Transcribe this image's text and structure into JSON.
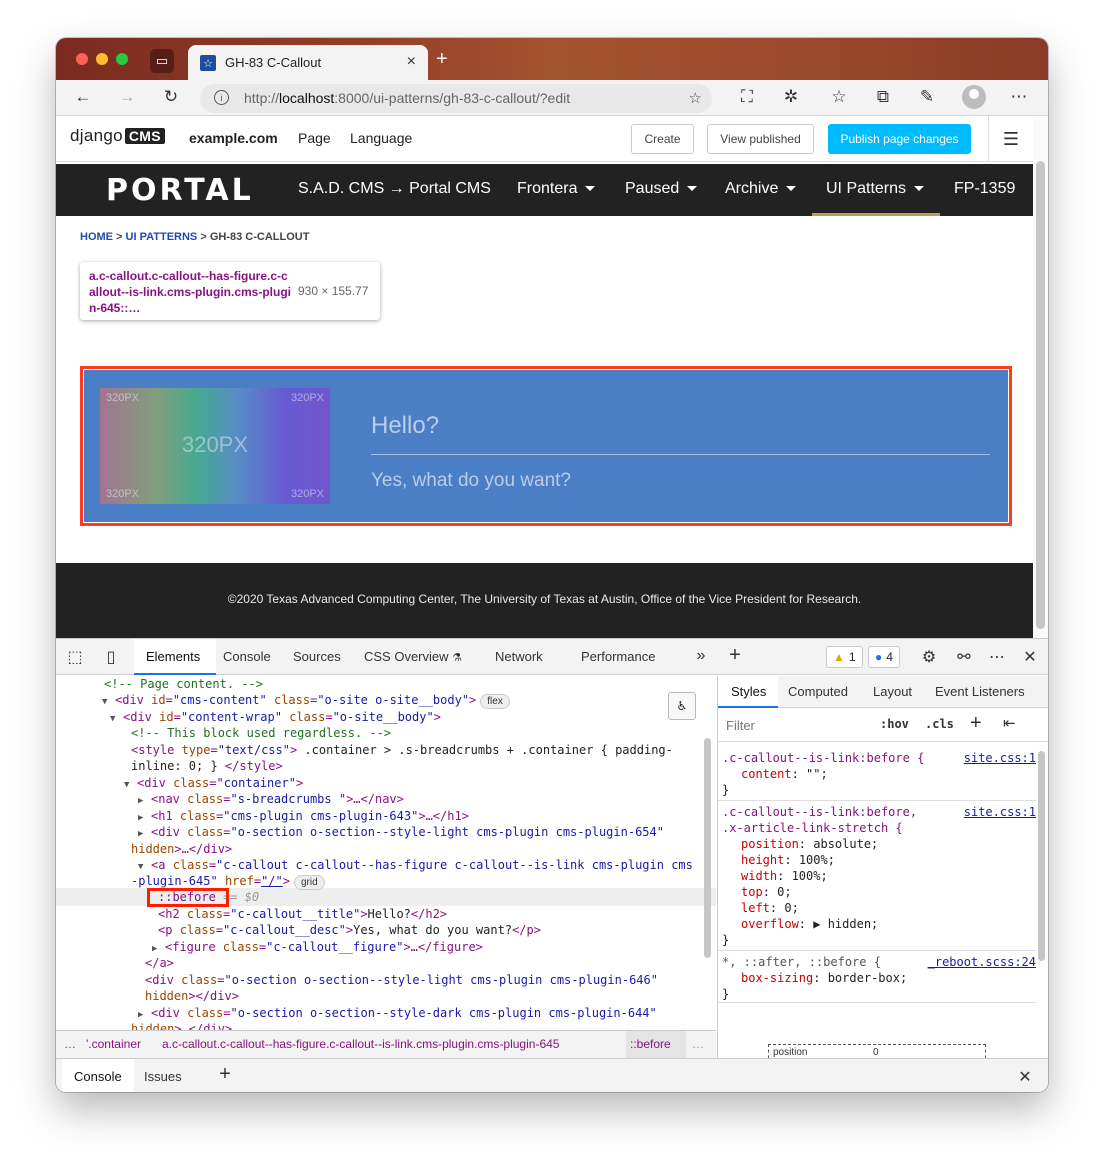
{
  "browser": {
    "tab_title": "GH-83 C-Callout",
    "url_prefix": "http://",
    "url_host": "localhost",
    "url_rest": ":8000/ui-patterns/gh-83-c-callout/?edit"
  },
  "cms_toolbar": {
    "logo_text": "django",
    "logo_box": "CMS",
    "site": "example.com",
    "menu_page": "Page",
    "menu_language": "Language",
    "create": "Create",
    "view_published": "View published",
    "publish": "Publish page changes"
  },
  "portal": {
    "logo": "PORTAL",
    "nav": [
      {
        "label": "S.A.D. CMS → Portal CMS"
      },
      {
        "label": "Frontera"
      },
      {
        "label": "Paused"
      },
      {
        "label": "Archive"
      },
      {
        "label": "UI Patterns"
      },
      {
        "label": "FP-1359"
      }
    ]
  },
  "breadcrumbs": {
    "home": "HOME",
    "sep": " > ",
    "ui_patterns": "UI PATTERNS",
    "current": "GH-83 C-CALLOUT"
  },
  "inspector_tooltip": {
    "selector": "a.c-callout.c-callout--has-figure.c-callout--is-link.cms-plugin.cms-plugin-645::…",
    "size": "930 × 155.77"
  },
  "callout": {
    "figure_corner": "320PX",
    "figure_center": "320PX",
    "title": "Hello?",
    "desc": "Yes, what do you want?"
  },
  "footer": {
    "text": "©2020 Texas Advanced Computing Center, The University of Texas at Austin, Office of the Vice President for Research."
  },
  "devtools": {
    "tabs": {
      "elements": "Elements",
      "console": "Console",
      "sources": "Sources",
      "css_overview": "CSS Overview",
      "network": "Network",
      "performance": "Performance"
    },
    "warnings": "1",
    "messages": "4",
    "dom": {
      "comment_page": "<!-- Page content. -->",
      "cmt_block": "<!-- This block used regardless. -->",
      "style_text": " .container > .s-breadcrumbs + .container { padding-",
      "style_text2": "inline: 0; } ",
      "h2_text": "Hello?",
      "p_text": "Yes, what do you want?",
      "before": "::before",
      "before_eq": " == $0",
      "pill_flex": "flex",
      "pill_grid": "grid"
    },
    "crumbs": {
      "ellipsis": "…",
      "container": "'.container",
      "element": "a.c-callout.c-callout--has-figure.c-callout--is-link.cms-plugin.cms-plugin-645",
      "before": "::before",
      "more": "…"
    },
    "styles": {
      "tabs": {
        "styles": "Styles",
        "computed": "Computed",
        "layout": "Layout",
        "event_listeners": "Event Listeners"
      },
      "filter_placeholder": "Filter",
      "hov": ":hov",
      "cls": ".cls",
      "rules": [
        {
          "selector": ".c-callout--is-link:before {",
          "source": "site.css:1",
          "props": [
            {
              "name": "content",
              "value": "\"\";"
            }
          ]
        },
        {
          "selector": ".c-callout--is-link:before,",
          "selector2": ".x-article-link-stretch {",
          "source": "site.css:1",
          "props": [
            {
              "name": "position",
              "value": "absolute;"
            },
            {
              "name": "height",
              "value": "100%;"
            },
            {
              "name": "width",
              "value": "100%;"
            },
            {
              "name": "top",
              "value": "0;"
            },
            {
              "name": "left",
              "value": "0;"
            },
            {
              "name": "overflow",
              "value": "▶ hidden;"
            }
          ]
        },
        {
          "selector": "*, ::after, ::before {",
          "source": "_reboot.scss:24",
          "props": [
            {
              "name": "box-sizing",
              "value": "border-box;"
            }
          ]
        }
      ],
      "close_brace": "}",
      "boxmodel_label": "position",
      "boxmodel_value": "0"
    },
    "drawer": {
      "console": "Console",
      "issues": "Issues"
    }
  },
  "colors": {
    "callout_bg": "#4a7fc6",
    "highlight": "#ff3a1f",
    "publish_btn": "#00bbff",
    "nav_active": "#bf9a5c"
  }
}
